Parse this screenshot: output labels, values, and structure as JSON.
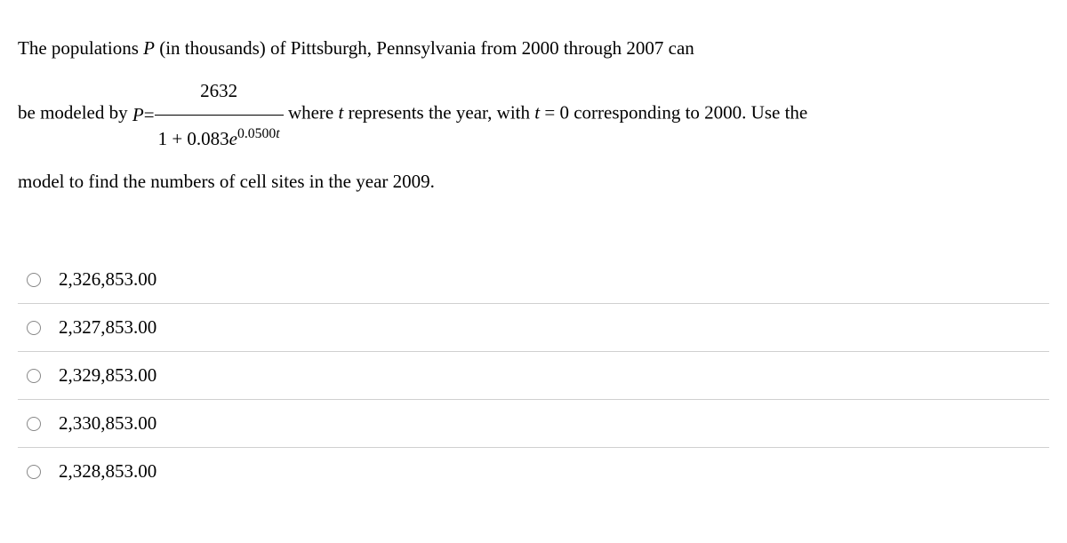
{
  "question": {
    "line1": "The populations ",
    "line1_var": "P",
    "line1_after_var": " (in thousands) of Pittsburgh, Pennsylvania from 2000 through 2007 can",
    "line2_before": "be modeled by ",
    "line2_lhs_var": "P",
    "line2_eq": " = ",
    "frac_num": "2632",
    "frac_den_a": "1 + 0.083",
    "frac_den_e": "e",
    "frac_den_sup_a": "0.0500",
    "frac_den_sup_t": "t",
    "line2_after_a": " where ",
    "line2_after_t": "t",
    "line2_after_b": " represents the year, with ",
    "line2_cond_var": "t",
    "line2_cond_eq": " = 0",
    "line2_after_c": " corresponding to 2000. Use the",
    "line3": "model to find the numbers of cell sites in the year 2009."
  },
  "options": [
    {
      "label": "2,326,853.00"
    },
    {
      "label": "2,327,853.00"
    },
    {
      "label": "2,329,853.00"
    },
    {
      "label": "2,330,853.00"
    },
    {
      "label": "2,328,853.00"
    }
  ]
}
